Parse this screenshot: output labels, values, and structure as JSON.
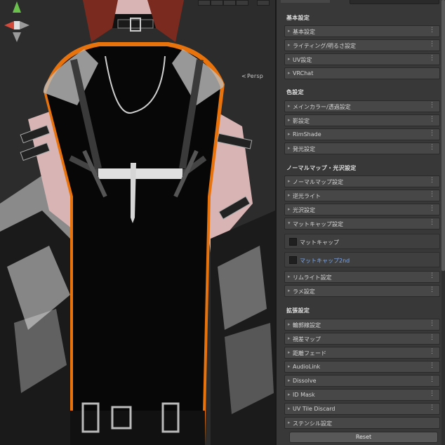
{
  "scene": {
    "persp_label": "Persp",
    "colors": {
      "outline": "#e8720c",
      "skin": "#d8b4b4",
      "clothes": "#070707",
      "background": "#2c2c2c"
    }
  },
  "inspector": {
    "sections": [
      {
        "title": "基本設定",
        "items": [
          "基本設定",
          "ライティング/明るさ設定",
          "UV設定",
          "VRChat"
        ]
      },
      {
        "title": "色設定",
        "items": [
          "メインカラー/透過設定",
          "影設定",
          "RimShade",
          "発光設定"
        ]
      },
      {
        "title": "ノーマルマップ・光沢設定",
        "items": [
          "ノーマルマップ設定",
          "逆光ライト",
          "光沢設定",
          "マットキャップ設定"
        ],
        "subitems": [
          "マットキャップ",
          "マットキャップ2nd"
        ],
        "items_after": [
          "リムライト設定",
          "ラメ設定"
        ]
      },
      {
        "title": "拡張設定",
        "items": [
          "輪郭線設定",
          "視差マップ",
          "距離フェード",
          "AudioLink",
          "Dissolve",
          "ID Mask",
          "UV Tile Discard",
          "ステンシル設定"
        ]
      }
    ],
    "reset_label": "Reset",
    "menu_glyph": "⋮",
    "arrow_glyph": "▸"
  }
}
